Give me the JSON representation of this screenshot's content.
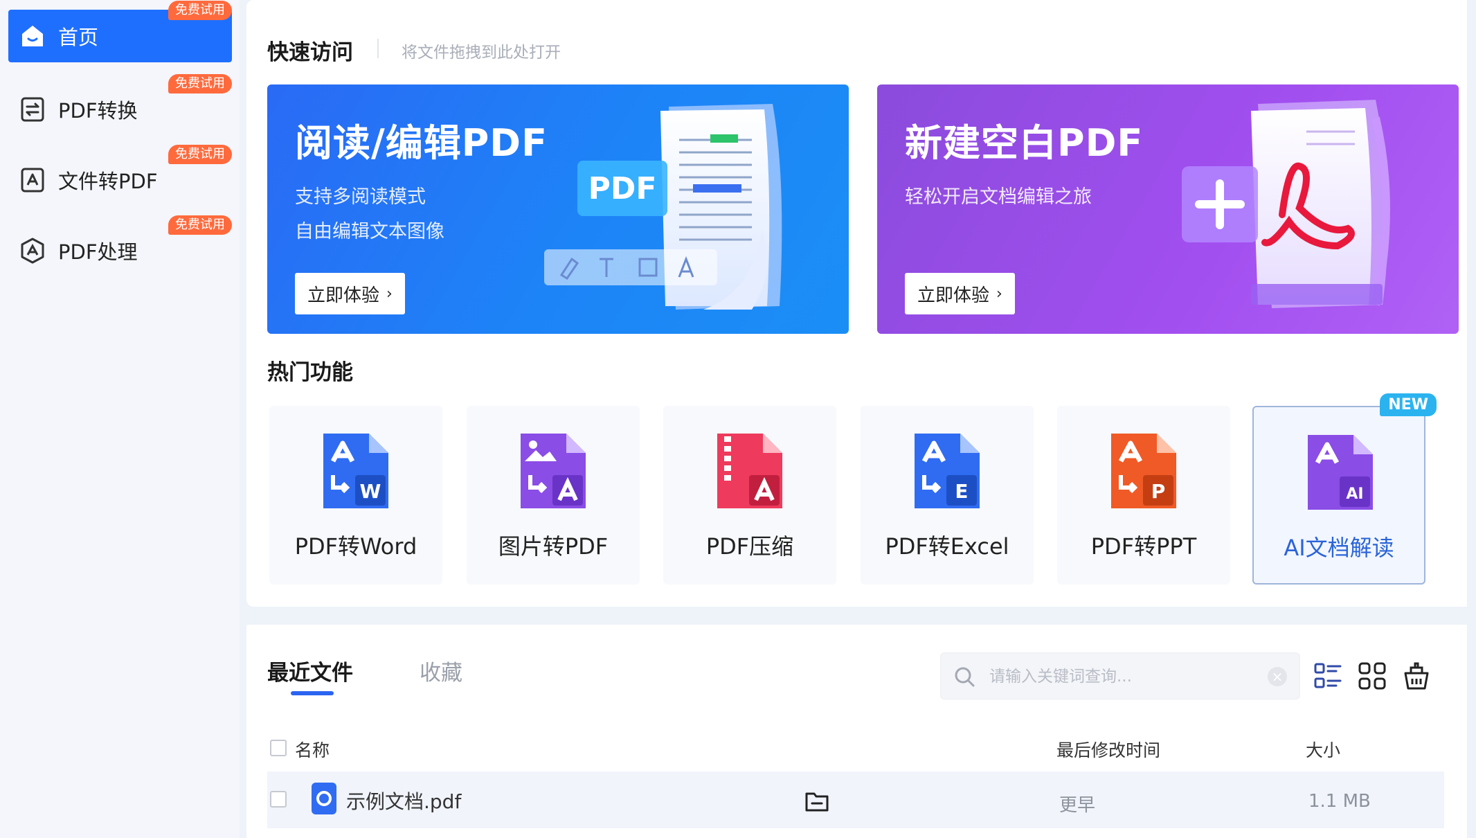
{
  "sidebar": {
    "items": [
      {
        "label": "首页",
        "badge": "免费试用",
        "icon": "home-icon",
        "active": true
      },
      {
        "label": "PDF转换",
        "badge": "免费试用",
        "icon": "convert-doc-icon"
      },
      {
        "label": "文件转PDF",
        "badge": "免费试用",
        "icon": "file-to-pdf-icon"
      },
      {
        "label": "PDF处理",
        "badge": "免费试用",
        "icon": "pdf-process-icon"
      }
    ]
  },
  "quick_access": {
    "title": "快速访问",
    "hint": "将文件拖拽到此处打开"
  },
  "banners": [
    {
      "title": "阅读/编辑PDF",
      "sub1": "支持多阅读模式",
      "sub2": "自由编辑文本图像",
      "button": "立即体验",
      "art_text": "PDF",
      "color": "#2a6af5"
    },
    {
      "title": "新建空白PDF",
      "sub1": "轻松开启文档编辑之旅",
      "button": "立即体验",
      "color": "#9b4ee8"
    }
  ],
  "hot_features": {
    "title": "热门功能",
    "tiles": [
      {
        "label": "PDF转Word",
        "icon": "pdf-to-word-icon",
        "letter": "W",
        "color": "#2f6cf2"
      },
      {
        "label": "图片转PDF",
        "icon": "image-to-pdf-icon",
        "color": "#8a4de6"
      },
      {
        "label": "PDF压缩",
        "icon": "pdf-compress-icon",
        "color": "#ee3a5c"
      },
      {
        "label": "PDF转Excel",
        "icon": "pdf-to-excel-icon",
        "letter": "E",
        "color": "#2f6cf2"
      },
      {
        "label": "PDF转PPT",
        "icon": "pdf-to-ppt-icon",
        "letter": "P",
        "color": "#f05a26"
      },
      {
        "label": "AI文档解读",
        "icon": "ai-doc-icon",
        "letter": "AI",
        "color": "#8a4de6",
        "badge": "NEW"
      }
    ]
  },
  "recent": {
    "tabs": [
      "最近文件",
      "收藏"
    ],
    "search_placeholder": "请输入关键词查询...",
    "clear": "×",
    "columns": {
      "name": "名称",
      "modified": "最后修改时间",
      "size": "大小"
    },
    "files": [
      {
        "name": "示例文档.pdf",
        "modified": "更早",
        "size": "1.1 MB"
      }
    ]
  }
}
